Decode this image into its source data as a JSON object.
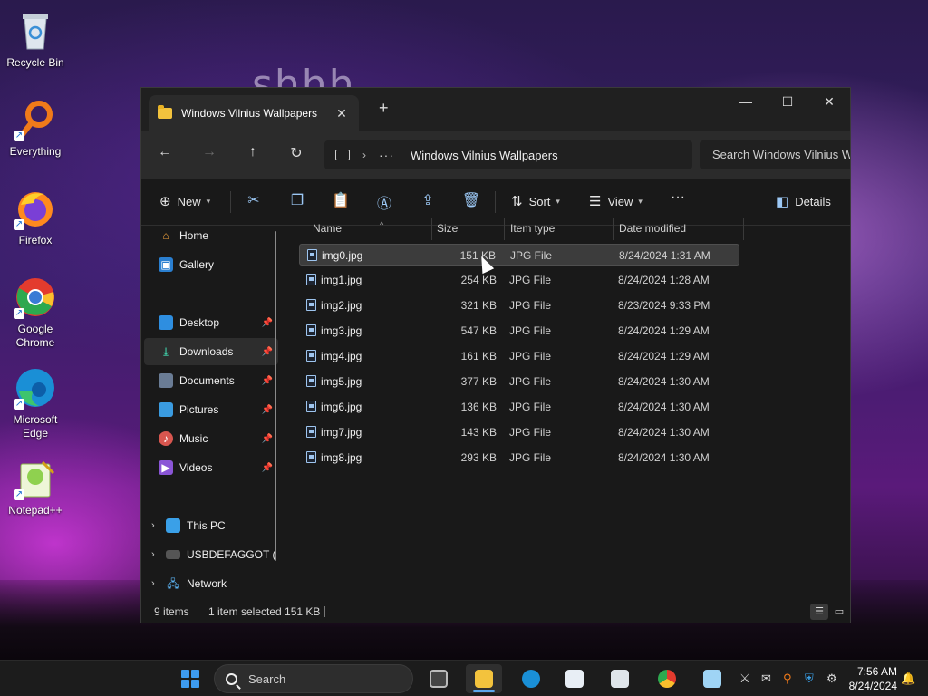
{
  "desktop": {
    "overlay_text": "shhh",
    "icons": [
      {
        "label": "Recycle Bin",
        "icon": "recycle-bin-icon"
      },
      {
        "label": "Everything",
        "icon": "everything-search-icon"
      },
      {
        "label": "Firefox",
        "icon": "firefox-icon"
      },
      {
        "label": "Google Chrome",
        "icon": "chrome-icon"
      },
      {
        "label": "Microsoft Edge",
        "icon": "edge-icon"
      },
      {
        "label": "Notepad++",
        "icon": "notepadpp-icon"
      }
    ]
  },
  "window": {
    "tab_title": "Windows Vilnius Wallpapers",
    "controls": {
      "minimize": "—",
      "maximize": "☐",
      "close": "✕"
    },
    "address": {
      "path": "Windows Vilnius Wallpapers",
      "overflow": "···"
    },
    "search_placeholder": "Search Windows Vilnius Wallpapers",
    "toolbar": {
      "new": "New",
      "sort": "Sort",
      "view": "View",
      "details": "Details",
      "more": "···"
    },
    "sidebar": {
      "home": "Home",
      "gallery": "Gallery",
      "quick": [
        "Desktop",
        "Downloads",
        "Documents",
        "Pictures",
        "Music",
        "Videos"
      ],
      "this_pc": "This PC",
      "usb": "USBDEFAGGOT (",
      "network": "Network"
    },
    "columns": {
      "name": "Name",
      "size": "Size",
      "type": "Item type",
      "date": "Date modified"
    },
    "files": [
      {
        "name": "img0.jpg",
        "size": "151 KB",
        "type": "JPG File",
        "date": "8/24/2024 1:31 AM"
      },
      {
        "name": "img1.jpg",
        "size": "254 KB",
        "type": "JPG File",
        "date": "8/24/2024 1:28 AM"
      },
      {
        "name": "img2.jpg",
        "size": "321 KB",
        "type": "JPG File",
        "date": "8/23/2024 9:33 PM"
      },
      {
        "name": "img3.jpg",
        "size": "547 KB",
        "type": "JPG File",
        "date": "8/24/2024 1:29 AM"
      },
      {
        "name": "img4.jpg",
        "size": "161 KB",
        "type": "JPG File",
        "date": "8/24/2024 1:29 AM"
      },
      {
        "name": "img5.jpg",
        "size": "377 KB",
        "type": "JPG File",
        "date": "8/24/2024 1:30 AM"
      },
      {
        "name": "img6.jpg",
        "size": "136 KB",
        "type": "JPG File",
        "date": "8/24/2024 1:30 AM"
      },
      {
        "name": "img7.jpg",
        "size": "143 KB",
        "type": "JPG File",
        "date": "8/24/2024 1:30 AM"
      },
      {
        "name": "img8.jpg",
        "size": "293 KB",
        "type": "JPG File",
        "date": "8/24/2024 1:30 AM"
      }
    ],
    "status": {
      "count": "9 items",
      "selection": "1 item selected  151 KB"
    }
  },
  "taskbar": {
    "search": "Search",
    "time": "7:56 AM",
    "date": "8/24/2024"
  },
  "colors": {
    "accent": "#3d9bf0",
    "folder": "#f3c33d"
  }
}
